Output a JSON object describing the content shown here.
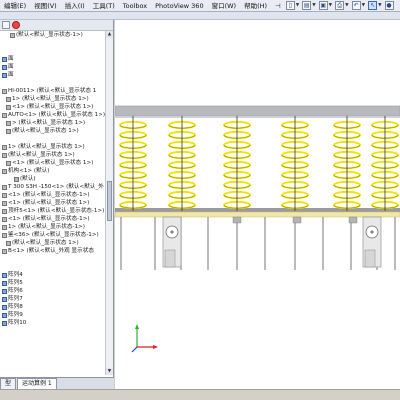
{
  "menu": {
    "items": [
      "编辑(E)",
      "视图(V)",
      "插入(I)",
      "工具(T)",
      "Toolbox",
      "PhotoView 360",
      "窗口(W)",
      "帮助(H)"
    ],
    "pin": "⊣"
  },
  "tree": {
    "rows": [
      {
        "text": "(默认<默认_显示状态-1>)",
        "indent": 2,
        "icon": "gray"
      },
      {
        "text": "",
        "indent": 0,
        "icon": "none"
      },
      {
        "text": "",
        "indent": 0,
        "icon": "none"
      },
      {
        "text": "面",
        "indent": 0,
        "icon": "blue"
      },
      {
        "text": "面",
        "indent": 0,
        "icon": "blue"
      },
      {
        "text": "面",
        "indent": 0,
        "icon": "blue"
      },
      {
        "text": "",
        "indent": 0,
        "icon": "none"
      },
      {
        "text": "HI-0011> (默认<默认_显示状态 1",
        "indent": 0,
        "icon": "gray"
      },
      {
        "text": "1> (默认<默认_显示状态 1>)",
        "indent": 1,
        "icon": "gray"
      },
      {
        "text": "<1> (默认<默认_显示状态 1>)",
        "indent": 1,
        "icon": "gray"
      },
      {
        "text": "AUTO<1> (默认<默认_显示状态 1>)",
        "indent": 0,
        "icon": "gray"
      },
      {
        "text": "> (默认<默认_显示状态 1>)",
        "indent": 1,
        "icon": "gray"
      },
      {
        "text": "(默认<默认_显示状态 1>)",
        "indent": 1,
        "icon": "gray"
      },
      {
        "text": "",
        "indent": 0,
        "icon": "none"
      },
      {
        "text": "1> (默认<默认_显示状态 1>)",
        "indent": 0,
        "icon": "gray"
      },
      {
        "text": "(默认<默认_显示状态 1>)",
        "indent": 0,
        "icon": "gray"
      },
      {
        "text": "<1> (默认<默认_显示状态 1>)",
        "indent": 1,
        "icon": "gray"
      },
      {
        "text": "机构<1> (默认)",
        "indent": 0,
        "icon": "gray"
      },
      {
        "text": "(默认)",
        "indent": 3,
        "icon": "gray"
      },
      {
        "text": "T 300 S3H -150<1> (默认<默认_外",
        "indent": 0,
        "icon": "gray"
      },
      {
        "text": "<1> (默认<默认_显示状态-1>)",
        "indent": 0,
        "icon": "gray"
      },
      {
        "text": "<1> (默认<默认_显示状态 1>)",
        "indent": 0,
        "icon": "gray"
      },
      {
        "text": "顶杆5<1> (默认<默认_显示状态-1>)",
        "indent": 0,
        "icon": "gray"
      },
      {
        "text": "<1> (默认<默认_显示状态-1>)",
        "indent": 0,
        "icon": "gray"
      },
      {
        "text": "1> (默认<默认_显示状态-1>)",
        "indent": 0,
        "icon": "gray"
      },
      {
        "text": "鉴<36> (默认<默认_显示状态-1>)",
        "indent": 0,
        "icon": "gray"
      },
      {
        "text": "(默认<默认_显示状态 1>)",
        "indent": 1,
        "icon": "gray"
      },
      {
        "text": "B<1> (默认<默认_外观 显示状态",
        "indent": 0,
        "icon": "gray"
      },
      {
        "text": "",
        "indent": 0,
        "icon": "none"
      },
      {
        "text": "",
        "indent": 0,
        "icon": "none"
      },
      {
        "text": "阵列4",
        "indent": 0,
        "icon": "blue"
      },
      {
        "text": "阵列5",
        "indent": 0,
        "icon": "blue"
      },
      {
        "text": "阵列6",
        "indent": 0,
        "icon": "blue"
      },
      {
        "text": "阵列7",
        "indent": 0,
        "icon": "blue"
      },
      {
        "text": "阵列8",
        "indent": 0,
        "icon": "blue"
      },
      {
        "text": "阵列9",
        "indent": 0,
        "icon": "blue"
      },
      {
        "text": "阵列10",
        "indent": 0,
        "icon": "blue"
      }
    ]
  },
  "tabs": {
    "model": "型",
    "motion": "运动算例 1"
  },
  "colors": {
    "spring": "#f2e200",
    "spring_dark": "#8f8200",
    "plate": "#f3e7a8",
    "band": "#b8b8bf",
    "band_dark": "#9a9aa2",
    "part": "#b4b4b4"
  },
  "viewport": {
    "spring_count_per_group": [
      1,
      1,
      1,
      1,
      1,
      1,
      1,
      1
    ]
  }
}
